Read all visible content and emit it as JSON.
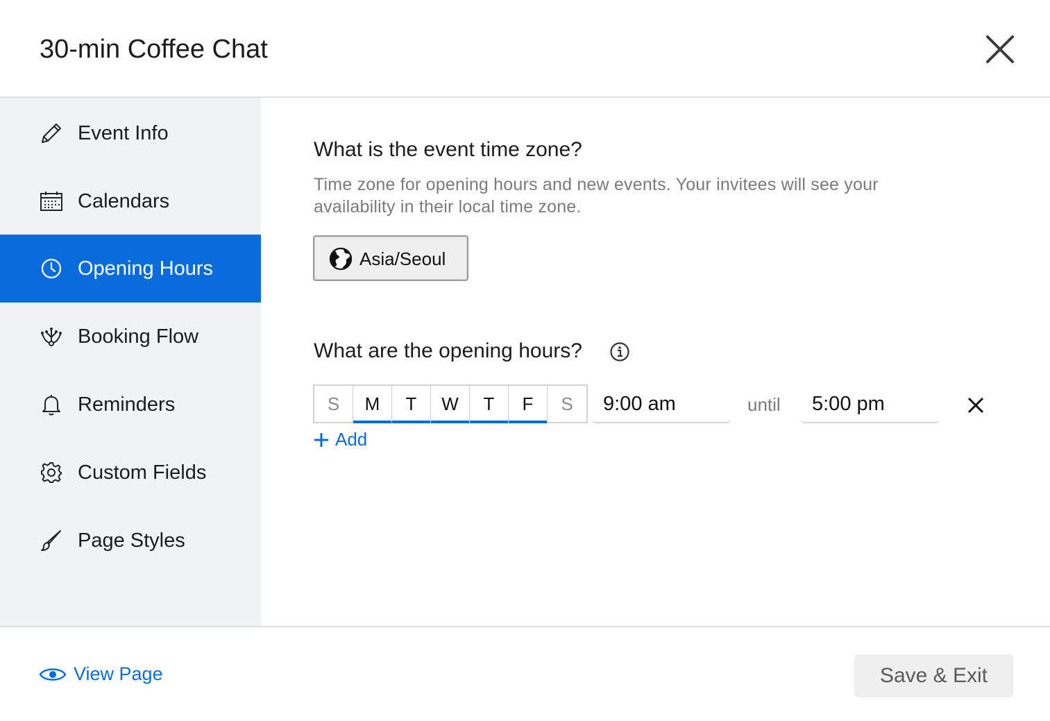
{
  "dialog": {
    "title": "30-min Coffee Chat"
  },
  "sidebar": {
    "items": [
      {
        "label": "Event Info",
        "icon": "pencil-icon"
      },
      {
        "label": "Calendars",
        "icon": "calendar-icon"
      },
      {
        "label": "Opening Hours",
        "icon": "clock-icon",
        "active": true
      },
      {
        "label": "Booking Flow",
        "icon": "flow-icon"
      },
      {
        "label": "Reminders",
        "icon": "bell-icon"
      },
      {
        "label": "Custom Fields",
        "icon": "gear-icon"
      },
      {
        "label": "Page Styles",
        "icon": "brush-icon"
      }
    ]
  },
  "timezone": {
    "heading": "What is the event time zone?",
    "description": "Time zone for opening hours and new events. Your invitees will see your availability in their local time zone.",
    "value": "Asia/Seoul"
  },
  "opening_hours": {
    "heading": "What are the opening hours?",
    "days": [
      {
        "label": "S",
        "selected": false
      },
      {
        "label": "M",
        "selected": true
      },
      {
        "label": "T",
        "selected": true
      },
      {
        "label": "W",
        "selected": true
      },
      {
        "label": "T",
        "selected": true
      },
      {
        "label": "F",
        "selected": true
      },
      {
        "label": "S",
        "selected": false
      }
    ],
    "start": "9:00 am",
    "until_label": "until",
    "end": "5:00 pm",
    "add_label": "Add"
  },
  "footer": {
    "view_page_label": "View Page",
    "save_label": "Save & Exit"
  },
  "colors": {
    "accent": "#0a6cdc",
    "sidebar_bg": "#f1f2f4",
    "muted_text": "#7a7a7a"
  }
}
